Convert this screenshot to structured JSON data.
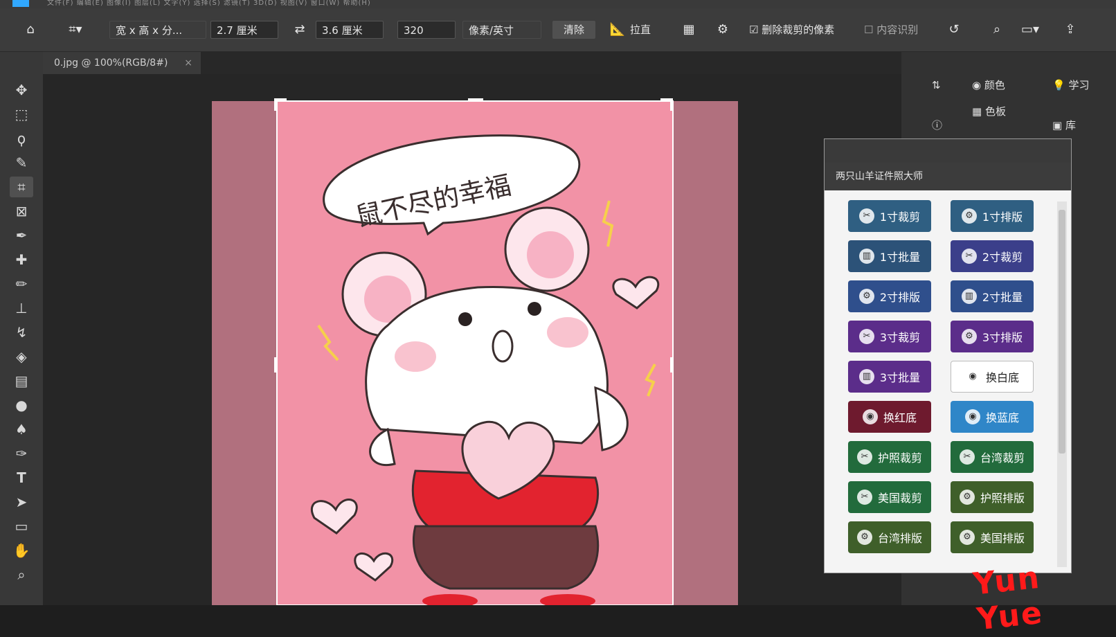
{
  "menubar": {
    "text": "文件(F)  编辑(E)  图像(I)  图层(L)  文字(Y)  选择(S)  滤镜(T)  3D(D)  视图(V)  窗口(W)  帮助(H)"
  },
  "options": {
    "ratio_label": "宽 x 高 x 分...",
    "width_value": "2.7 厘米",
    "swap_symbol": "⇄",
    "height_value": "3.6 厘米",
    "resolution_value": "320",
    "unit_label": "像素/英寸",
    "clear_label": "清除",
    "straighten_label": "拉直",
    "delete_pixels_label": "删除裁剪的像素",
    "content_aware_label": "内容识别"
  },
  "document": {
    "tab_title": "0.jpg @ 100%(RGB/8#)",
    "close": "×"
  },
  "canvas": {
    "speech_text": "鼠不尽的幸福"
  },
  "right_panels": {
    "color_label": "颜色",
    "swatches_label": "色板",
    "learn_label": "学习",
    "library_label": "库"
  },
  "plugin": {
    "title": "两只山羊证件照大师",
    "buttons": [
      {
        "label": "1寸裁剪",
        "color": "#2f5f82",
        "icon": "scissors-icon"
      },
      {
        "label": "1寸排版",
        "color": "#2f5f82",
        "icon": "layout-icon"
      },
      {
        "label": "1寸批量",
        "color": "#2c5278",
        "icon": "batch-icon"
      },
      {
        "label": "2寸裁剪",
        "color": "#3b3f8a",
        "icon": "scissors-icon"
      },
      {
        "label": "2寸排版",
        "color": "#2f4f8c",
        "icon": "layout-icon"
      },
      {
        "label": "2寸批量",
        "color": "#2f4f8c",
        "icon": "batch-icon"
      },
      {
        "label": "3寸裁剪",
        "color": "#5b2d8a",
        "icon": "scissors-icon"
      },
      {
        "label": "3寸排版",
        "color": "#5b2d8a",
        "icon": "layout-icon"
      },
      {
        "label": "3寸批量",
        "color": "#5b2d8a",
        "icon": "batch-icon"
      },
      {
        "label": "换白底",
        "color": "#ffffff",
        "icon": "film-icon"
      },
      {
        "label": "换红底",
        "color": "#6e1a2e",
        "icon": "film-icon"
      },
      {
        "label": "换蓝底",
        "color": "#2f86c8",
        "icon": "film-icon"
      },
      {
        "label": "护照裁剪",
        "color": "#226b3c",
        "icon": "scissors-icon"
      },
      {
        "label": "台湾裁剪",
        "color": "#226b3c",
        "icon": "scissors-icon"
      },
      {
        "label": "美国裁剪",
        "color": "#226b3c",
        "icon": "scissors-icon"
      },
      {
        "label": "护照排版",
        "color": "#3f5f2a",
        "icon": "layout-icon"
      },
      {
        "label": "台湾排版",
        "color": "#3f5f2a",
        "icon": "layout-icon"
      },
      {
        "label": "美国排版",
        "color": "#3f5f2a",
        "icon": "layout-icon"
      }
    ]
  },
  "watermark": {
    "text": "Yun Yue"
  }
}
